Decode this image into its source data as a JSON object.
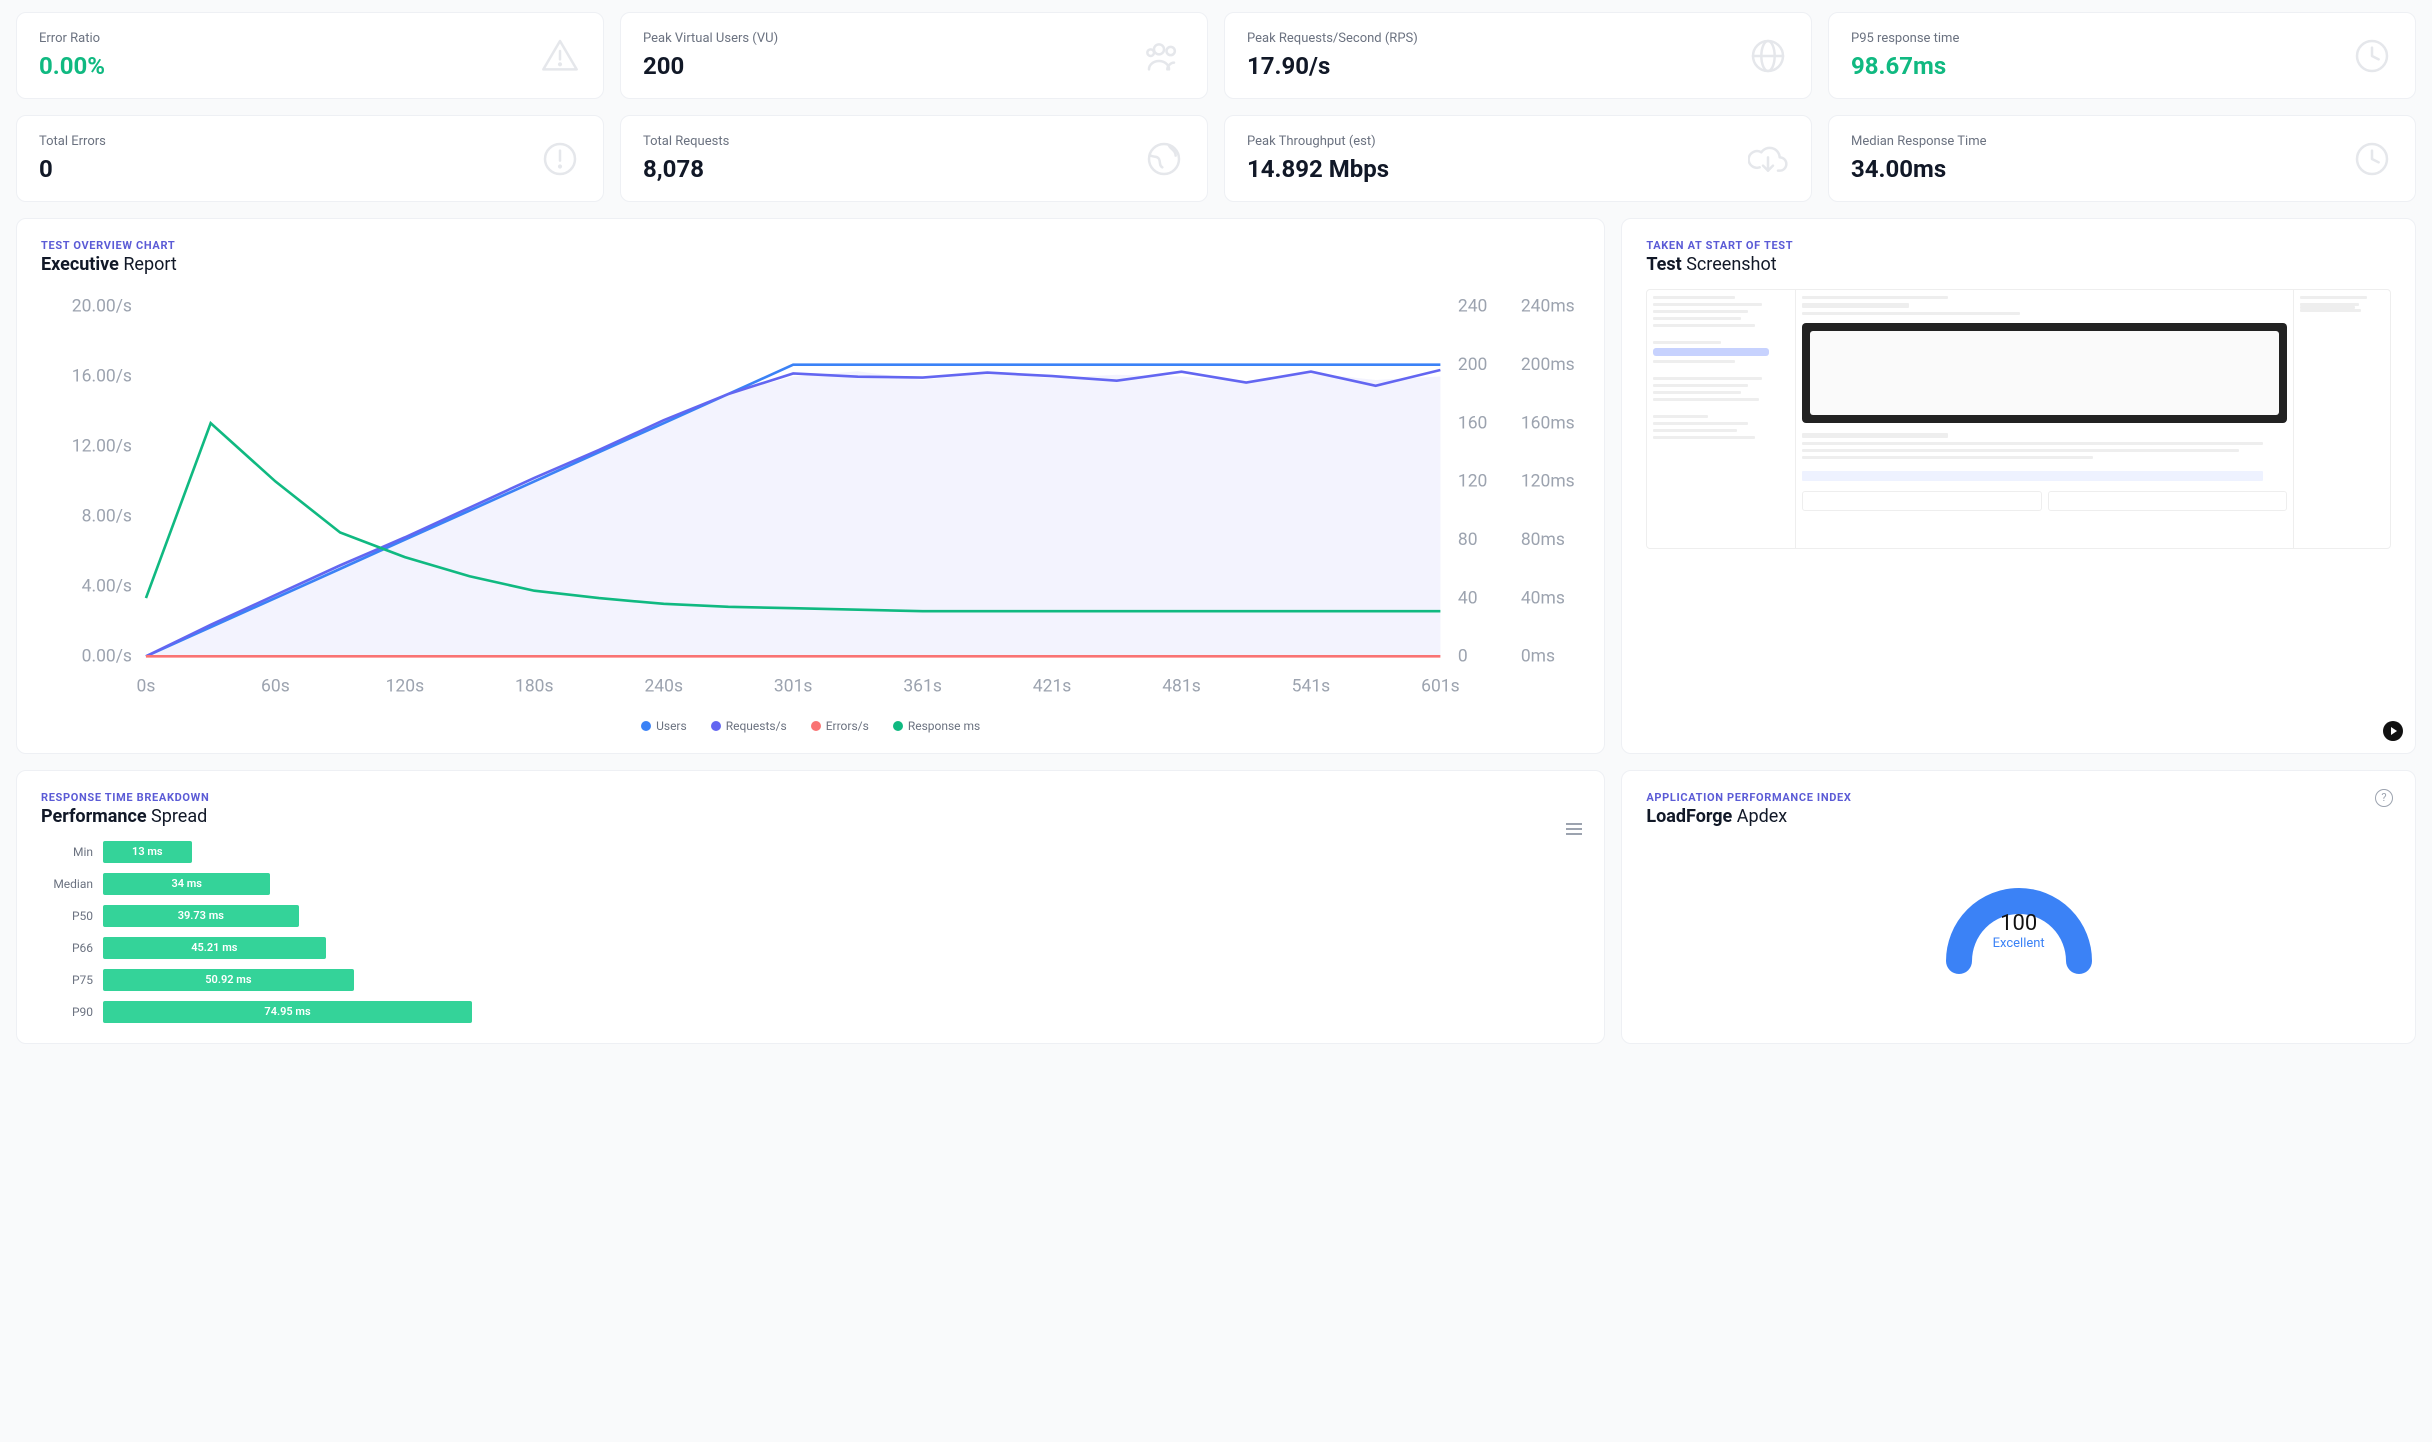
{
  "stats_row1": [
    {
      "label": "Error Ratio",
      "value": "0.00%",
      "green": true,
      "icon": "warning-triangle-icon"
    },
    {
      "label": "Peak Virtual Users (VU)",
      "value": "200",
      "green": false,
      "icon": "users-icon"
    },
    {
      "label": "Peak Requests/Second (RPS)",
      "value": "17.90/s",
      "green": false,
      "icon": "globe-icon"
    },
    {
      "label": "P95 response time",
      "value": "98.67ms",
      "green": true,
      "icon": "clock-icon"
    }
  ],
  "stats_row2": [
    {
      "label": "Total Errors",
      "value": "0",
      "green": false,
      "icon": "alert-circle-icon"
    },
    {
      "label": "Total Requests",
      "value": "8,078",
      "green": false,
      "icon": "earth-icon"
    },
    {
      "label": "Peak Throughput (est)",
      "value": "14.892 Mbps",
      "green": false,
      "icon": "download-cloud-icon"
    },
    {
      "label": "Median Response Time",
      "value": "34.00ms",
      "green": false,
      "icon": "clock-icon"
    }
  ],
  "overview_panel": {
    "eyebrow": "TEST OVERVIEW CHART",
    "title_bold": "Executive",
    "title_rest": " Report"
  },
  "screenshot_panel": {
    "eyebrow": "TAKEN AT START OF TEST",
    "title_bold": "Test",
    "title_rest": " Screenshot"
  },
  "perf_panel": {
    "eyebrow": "RESPONSE TIME BREAKDOWN",
    "title_bold": "Performance",
    "title_rest": " Spread"
  },
  "apdex_panel": {
    "eyebrow": "APPLICATION PERFORMANCE INDEX",
    "title_bold": "LoadForge",
    "title_rest": " Apdex",
    "score": "100",
    "rating": "Excellent"
  },
  "chart_data": {
    "overview": {
      "type": "line",
      "x_ticks": [
        "0s",
        "60s",
        "120s",
        "180s",
        "240s",
        "301s",
        "361s",
        "421s",
        "481s",
        "541s",
        "601s"
      ],
      "y_left_ticks": [
        "0.00/s",
        "4.00/s",
        "8.00/s",
        "12.00/s",
        "16.00/s",
        "20.00/s"
      ],
      "y_right1_ticks": [
        "0",
        "40",
        "80",
        "120",
        "160",
        "200",
        "240"
      ],
      "y_right2_ticks": [
        "0ms",
        "40ms",
        "80ms",
        "120ms",
        "160ms",
        "200ms",
        "240ms"
      ],
      "legend": [
        {
          "name": "Users",
          "color": "#3b82f6"
        },
        {
          "name": "Requests/s",
          "color": "#6366f1"
        },
        {
          "name": "Errors/s",
          "color": "#f97373"
        },
        {
          "name": "Response ms",
          "color": "#10b981"
        }
      ],
      "series": {
        "users": [
          0,
          20,
          40,
          60,
          80,
          100,
          120,
          140,
          160,
          180,
          200,
          200,
          200,
          200,
          200,
          200,
          200,
          200,
          200,
          200,
          200
        ],
        "requests_s": [
          0,
          1.8,
          3.5,
          5.2,
          6.8,
          8.5,
          10.2,
          11.8,
          13.5,
          15,
          16,
          16.3,
          15.8,
          16.2,
          15.9,
          16.1,
          16.0,
          15.7,
          16.2,
          15.8,
          16.0
        ],
        "errors_s": [
          0,
          0,
          0,
          0,
          0,
          0,
          0,
          0,
          0,
          0,
          0,
          0,
          0,
          0,
          0,
          0,
          0,
          0,
          0,
          0,
          0
        ],
        "response_ms": [
          40,
          160,
          120,
          85,
          68,
          55,
          45,
          40,
          36,
          34,
          33,
          32,
          31,
          31,
          31,
          31,
          31,
          31,
          31,
          31,
          31
        ]
      },
      "y_left_max": 20,
      "y_right1_max": 240,
      "y_right2_max": 240
    },
    "performance_spread": {
      "type": "bar",
      "max": 300,
      "bars": [
        {
          "label": "Min",
          "value": 13,
          "text": "13 ms"
        },
        {
          "label": "Median",
          "value": 34,
          "text": "34 ms"
        },
        {
          "label": "P50",
          "value": 39.73,
          "text": "39.73 ms"
        },
        {
          "label": "P66",
          "value": 45.21,
          "text": "45.21 ms"
        },
        {
          "label": "P75",
          "value": 50.92,
          "text": "50.92 ms"
        },
        {
          "label": "P90",
          "value": 74.95,
          "text": "74.95 ms"
        }
      ]
    }
  }
}
